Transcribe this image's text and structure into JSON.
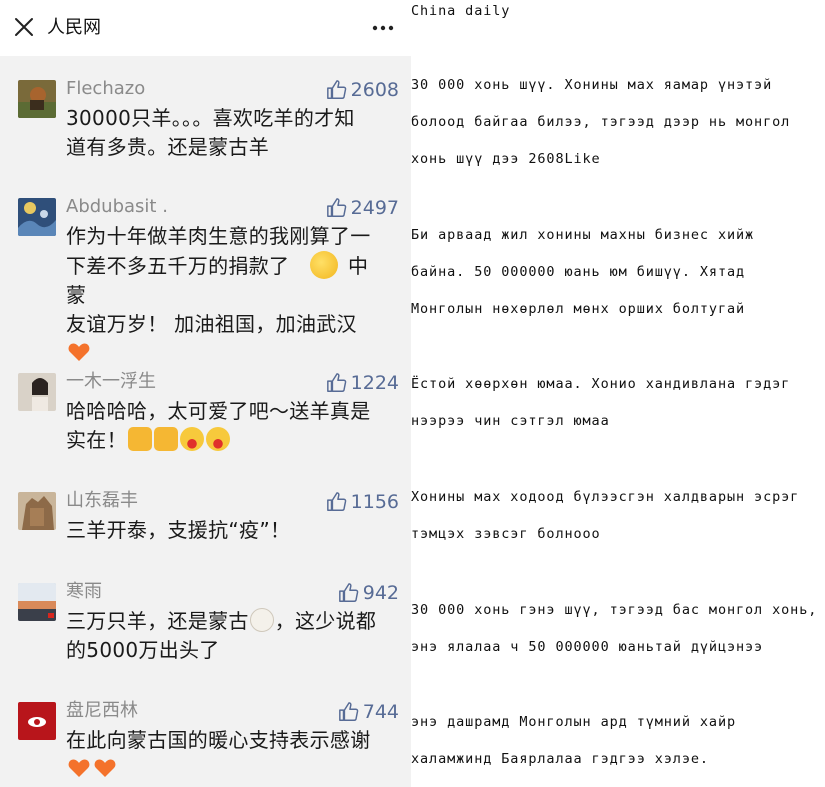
{
  "app": {
    "title": "人民网",
    "close_icon": "close-icon",
    "more_icon": "more-dots-icon"
  },
  "colors": {
    "likes_blue": "#576b95",
    "username_gray": "#8a8a8a",
    "background": "#f2f2f2"
  },
  "comments": [
    {
      "username": "Flechazo",
      "likes": "2608",
      "avatar": "avatar-image",
      "text_lines": [
        "30000只羊。。。喜欢吃羊的才知",
        "道有多贵。还是蒙古羊"
      ]
    },
    {
      "username": "Abdubasit .",
      "likes": "2497",
      "avatar": "avatar-image",
      "text_lines": [
        "作为十年做羊肉生意的我刚算了一",
        "下差不多五千万的捐款了",
        "友谊万岁！ 加油祖国，加油武汉"
      ]
    },
    {
      "username": "一木一浮生",
      "likes": "1224",
      "avatar": "avatar-image",
      "text_lines": [
        "哈哈哈哈，太可爱了吧～送羊真是",
        "实在！"
      ]
    },
    {
      "username": "山东磊丰",
      "likes": "1156",
      "avatar": "avatar-image",
      "text_lines": [
        "三羊开泰，支援抗“疫”！"
      ]
    },
    {
      "username": "寒雨",
      "likes": "942",
      "avatar": "avatar-image",
      "text_lines": [
        "三万只羊，还是蒙古",
        "，这少说都",
        "的5000万出头了"
      ]
    },
    {
      "username": "盘尼西林",
      "likes": "744",
      "avatar": "avatar-image",
      "text_lines": [
        "在此向蒙古国的暖心支持表示感谢"
      ]
    }
  ],
  "comment2_inline_tail": "中蒙",
  "emojis": {
    "c2": [
      "thinking-emoji",
      "orange-heart-emoji"
    ],
    "c3": [
      "thumbs-up-emoji",
      "thumbs-up-emoji",
      "shocked-face-emoji",
      "shocked-face-emoji"
    ],
    "c5": [
      "sheep-emoji"
    ],
    "c6": [
      "orange-heart-emoji",
      "orange-heart-emoji"
    ]
  },
  "translation": {
    "source": "China daily",
    "blocks": [
      [
        "30 000 хонь шүү. Хонины мах яамар үнэтэй",
        "болоод байгаа билээ, тэгээд дээр нь монгол",
        "хонь шүү дээ 2608Like"
      ],
      [
        "Би арваад жил хонины махны бизнес хийж",
        "байна. 50 000000 юань юм бишүү. Хятад",
        "Монголын нөхөрлөл мөнх орших болтугай"
      ],
      [
        "Ёстой хөөрхөн юмаа. Хонио хандивлана гэдэг",
        "нээрээ чин сэтгэл юмаа"
      ],
      [
        "Хонины мах ходоод бүлээсгэн халдварын эсрэг",
        "тэмцэх зэвсэг болнооо"
      ],
      [
        "30 000 хонь гэнэ шүү, тэгээд бас монгол хонь,",
        "энэ ялалаа ч 50 000000 юаньтай дүйцэнээ"
      ],
      [
        "энэ дашрамд Монголын ард түмний хайр",
        "халамжинд Баярлалаа гэдгээ хэлэе."
      ]
    ]
  }
}
